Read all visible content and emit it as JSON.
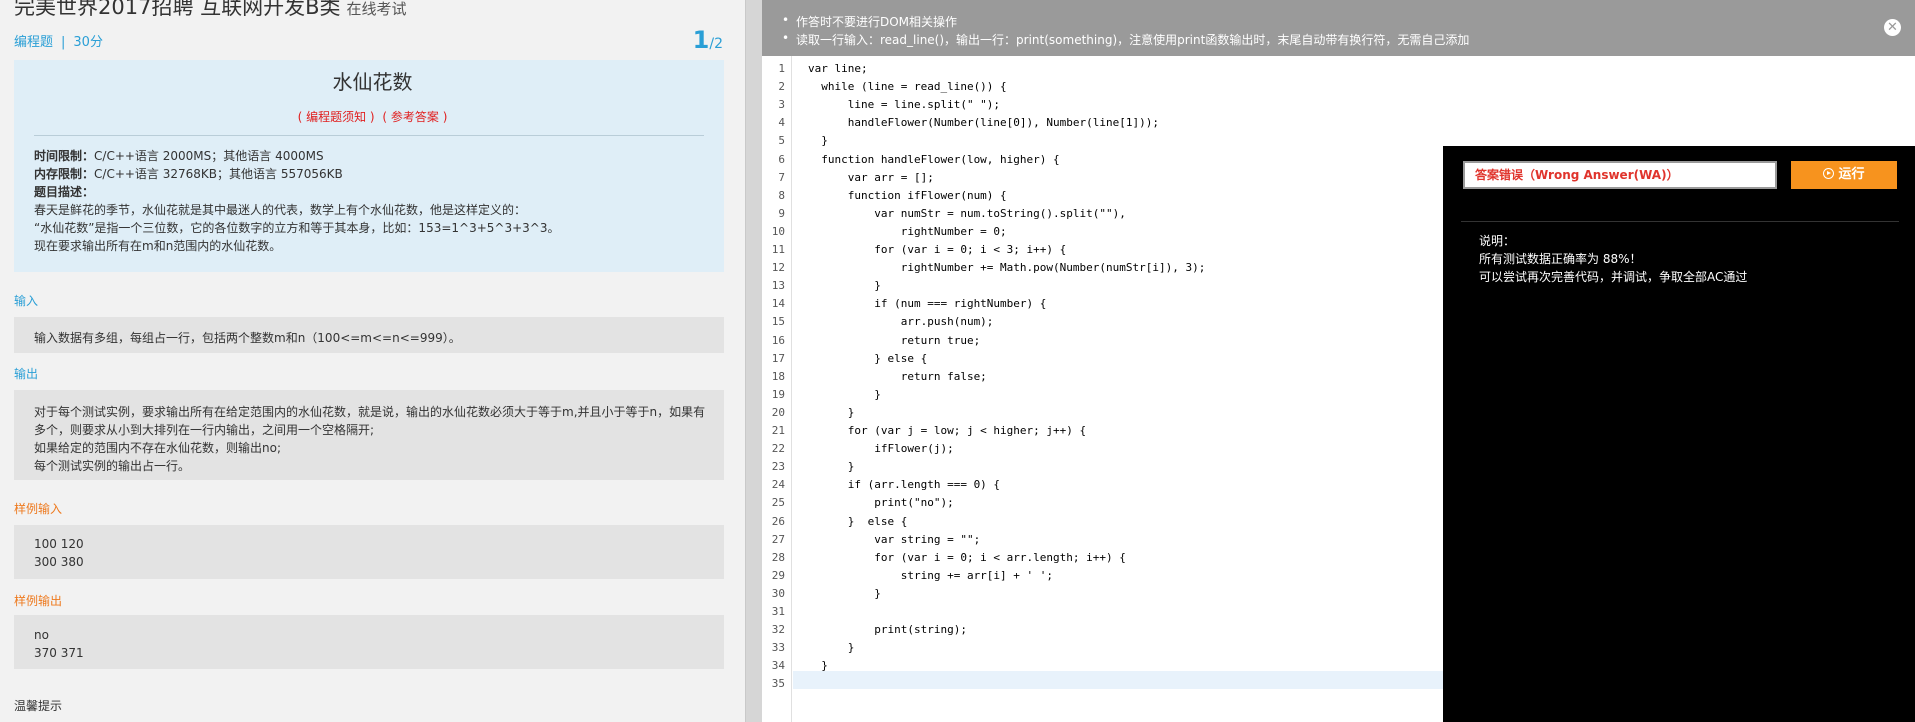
{
  "header": {
    "title": "完美世界2017招聘 互联网开发B类",
    "subtitle": "在线考试",
    "type_label": "编程题",
    "separator": "|",
    "score": "30分",
    "current_page": "1",
    "total_pages": "/2"
  },
  "problem": {
    "name": "水仙花数",
    "link_guide": "( 编程题须知 )",
    "link_answer": "( 参考答案 )",
    "time_limit_label": "时间限制：",
    "time_limit_value": "C/C++语言 2000MS；其他语言 4000MS",
    "memory_limit_label": "内存限制：",
    "memory_limit_value": "C/C++语言 32768KB；其他语言 557056KB",
    "desc_label": "题目描述：",
    "desc_lines": [
      "春天是鲜花的季节，水仙花就是其中最迷人的代表，数学上有个水仙花数，他是这样定义的：",
      "“水仙花数”是指一个三位数，它的各位数字的立方和等于其本身，比如：153=1^3+5^3+3^3。",
      "现在要求输出所有在m和n范围内的水仙花数。"
    ]
  },
  "sections": {
    "input_label": "输入",
    "input_text": "输入数据有多组，每组占一行，包括两个整数m和n（100<=m<=n<=999）。",
    "output_label": "输出",
    "output_lines": [
      "对于每个测试实例，要求输出所有在给定范围内的水仙花数，就是说，输出的水仙花数必须大于等于m,并且小于等于n，如果有",
      "多个，则要求从小到大排列在一行内输出，之间用一个空格隔开;",
      "如果给定的范围内不存在水仙花数，则输出no;",
      "每个测试实例的输出占一行。"
    ],
    "sample_input_label": "样例输入",
    "sample_input_lines": [
      "100 120",
      "300 380"
    ],
    "sample_output_label": "样例输出",
    "sample_output_lines": [
      "no",
      "370 371"
    ],
    "tip_label": "温馨提示"
  },
  "notice": {
    "line1": "作答时不要进行DOM相关操作",
    "line2": "读取一行输入：read_line()，输出一行：print(something)，注意使用print函数输出时，末尾自动带有换行符，无需自己添加"
  },
  "code_lines": [
    "var line;",
    "  while (line = read_line()) {",
    "      line = line.split(\" \");",
    "      handleFlower(Number(line[0]), Number(line[1]));",
    "  }",
    "  function handleFlower(low, higher) {",
    "      var arr = [];",
    "      function ifFlower(num) {",
    "          var numStr = num.toString().split(\"\"),",
    "              rightNumber = 0;",
    "          for (var i = 0; i < 3; i++) {",
    "              rightNumber += Math.pow(Number(numStr[i]), 3);",
    "          }",
    "          if (num === rightNumber) {",
    "              arr.push(num);",
    "              return true;",
    "          } else {",
    "              return false;",
    "          }",
    "      }",
    "      for (var j = low; j < higher; j++) {",
    "          ifFlower(j);",
    "      }",
    "      if (arr.length === 0) {",
    "          print(\"no\");",
    "      }  else {",
    "          var string = \"\";",
    "          for (var i = 0; i < arr.length; i++) {",
    "              string += arr[i] + ' ';",
    "          }",
    "",
    "          print(string);",
    "      }",
    "  }",
    ""
  ],
  "result": {
    "verdict": "答案错误（Wrong Answer(WA)）",
    "run_label": "运行",
    "console_title": "说明：",
    "console_line1": "所有测试数据正确率为 88%！",
    "console_line2": "可以尝试再次完善代码，并调试，争取全部AC通过"
  }
}
